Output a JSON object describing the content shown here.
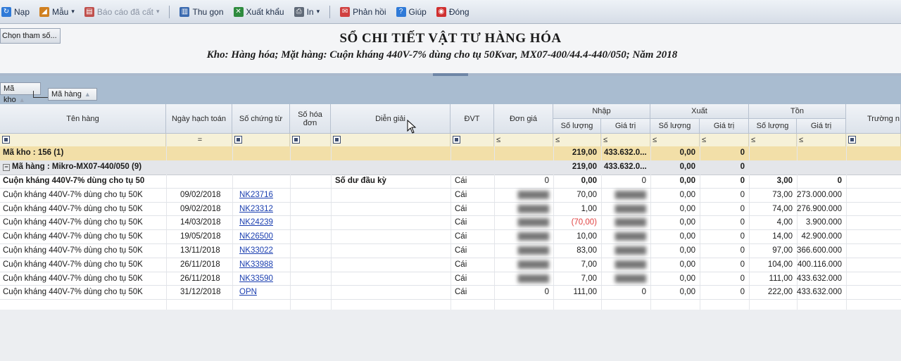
{
  "toolbar": {
    "items": [
      {
        "label": "Nạp",
        "icon": "refresh-icon",
        "color": "#2f7ad8"
      },
      {
        "label": "Mẫu",
        "icon": "template-icon",
        "color": "#d08020"
      },
      {
        "label": "Báo cáo đã cất",
        "icon": "save-report-icon",
        "color": "#c0504d"
      },
      {
        "label": "Thu gọn",
        "icon": "collapse-icon",
        "color": "#3a6ab0"
      },
      {
        "label": "Xuất khẩu",
        "icon": "excel-export-icon",
        "color": "#2e8b3e"
      },
      {
        "label": "In",
        "icon": "printer-icon",
        "color": "#606a78"
      },
      {
        "label": "Phản hồi",
        "icon": "feedback-icon",
        "color": "#d04040"
      },
      {
        "label": "Giúp",
        "icon": "help-icon",
        "color": "#2f7ad8"
      },
      {
        "label": "Đóng",
        "icon": "close-icon",
        "color": "#d03030"
      }
    ]
  },
  "report": {
    "chon_label": "Chọn tham số...",
    "title": "SỔ CHI TIẾT VẬT TƯ HÀNG HÓA",
    "subtitle": "Kho: Hàng hóa; Mặt hàng: Cuộn kháng 440V-7% dùng cho tụ 50Kvar, MX07-400/44.4-440/050; Năm 2018"
  },
  "grouping": {
    "level1": "Mã kho",
    "level2": "Mã hàng"
  },
  "columns": {
    "ten_hang": "Tên hàng",
    "ngay_hach_toan": "Ngày hạch toán",
    "so_chung_tu": "Số chứng từ",
    "so_hoa_don": "Số hóa đơn",
    "dien_giai": "Diễn giải",
    "dvt": "ĐVT",
    "don_gia": "Đơn giá",
    "nhap": "Nhập",
    "xuat": "Xuất",
    "ton": "Tồn",
    "so_luong": "Số lượng",
    "gia_tri": "Giá trị",
    "truong": "Trường n"
  },
  "filter": {
    "eq": "=",
    "le": "≤"
  },
  "group_rows": {
    "kho": {
      "label": "Mã kho : 156 (1)",
      "nhap_sl": "219,00",
      "nhap_gt": "433.632.0...",
      "xuat_sl": "0,00",
      "xuat_gt": "0"
    },
    "hang": {
      "label": "Mã hàng : Mikro-MX07-440/050 (9)",
      "nhap_sl": "219,00",
      "nhap_gt": "433.632.0...",
      "xuat_sl": "0,00",
      "xuat_gt": "0"
    }
  },
  "rows": [
    {
      "ten_hang": "Cuộn kháng 440V-7% dùng cho tụ 50",
      "ngay": "",
      "so_ct": "",
      "dien_giai": "Số dư đầu kỳ",
      "dvt": "Cái",
      "don_gia": "0",
      "nhap_sl": "0,00",
      "nhap_gt": "0",
      "xuat_sl": "0,00",
      "xuat_gt": "0",
      "ton_sl": "3,00",
      "ton_gt": "0",
      "bold": true
    },
    {
      "ten_hang": "Cuộn kháng 440V-7% dùng cho tụ 50K",
      "ngay": "09/02/2018",
      "so_ct": "NK23716",
      "dien_giai": "",
      "dvt": "Cái",
      "don_gia": "",
      "nhap_sl": "70,00",
      "nhap_gt": "",
      "xuat_sl": "0,00",
      "xuat_gt": "0",
      "ton_sl": "73,00",
      "ton_gt": "273.000.000"
    },
    {
      "ten_hang": "Cuộn kháng 440V-7% dùng cho tụ 50K",
      "ngay": "09/02/2018",
      "so_ct": "NK23312",
      "dien_giai": "",
      "dvt": "Cái",
      "don_gia": "",
      "nhap_sl": "1,00",
      "nhap_gt": "",
      "xuat_sl": "0,00",
      "xuat_gt": "0",
      "ton_sl": "74,00",
      "ton_gt": "276.900.000"
    },
    {
      "ten_hang": "Cuộn kháng 440V-7% dùng cho tụ 50K",
      "ngay": "14/03/2018",
      "so_ct": "NK24239",
      "dien_giai": "",
      "dvt": "Cái",
      "don_gia": "",
      "nhap_sl": "(70,00)",
      "nhap_gt": "",
      "xuat_sl": "0,00",
      "xuat_gt": "0",
      "ton_sl": "4,00",
      "ton_gt": "3.900.000",
      "neg": true
    },
    {
      "ten_hang": "Cuộn kháng 440V-7% dùng cho tụ 50K",
      "ngay": "19/05/2018",
      "so_ct": "NK26500",
      "dien_giai": "",
      "dvt": "Cái",
      "don_gia": "",
      "nhap_sl": "10,00",
      "nhap_gt": "",
      "xuat_sl": "0,00",
      "xuat_gt": "0",
      "ton_sl": "14,00",
      "ton_gt": "42.900.000"
    },
    {
      "ten_hang": "Cuộn kháng 440V-7% dùng cho tụ 50K",
      "ngay": "13/11/2018",
      "so_ct": "NK33022",
      "dien_giai": "",
      "dvt": "Cái",
      "don_gia": "",
      "nhap_sl": "83,00",
      "nhap_gt": "",
      "xuat_sl": "0,00",
      "xuat_gt": "0",
      "ton_sl": "97,00",
      "ton_gt": "366.600.000"
    },
    {
      "ten_hang": "Cuộn kháng 440V-7% dùng cho tụ 50K",
      "ngay": "26/11/2018",
      "so_ct": "NK33988",
      "dien_giai": "",
      "dvt": "Cái",
      "don_gia": "",
      "nhap_sl": "7,00",
      "nhap_gt": "",
      "xuat_sl": "0,00",
      "xuat_gt": "0",
      "ton_sl": "104,00",
      "ton_gt": "400.116.000"
    },
    {
      "ten_hang": "Cuộn kháng 440V-7% dùng cho tụ 50K",
      "ngay": "26/11/2018",
      "so_ct": "NK33590",
      "dien_giai": "",
      "dvt": "Cái",
      "don_gia": "",
      "nhap_sl": "7,00",
      "nhap_gt": "",
      "xuat_sl": "0,00",
      "xuat_gt": "0",
      "ton_sl": "111,00",
      "ton_gt": "433.632.000"
    },
    {
      "ten_hang": "Cuộn kháng 440V-7% dùng cho tụ 50K",
      "ngay": "31/12/2018",
      "so_ct": "OPN",
      "dien_giai": "",
      "dvt": "Cái",
      "don_gia": "0",
      "nhap_sl": "111,00",
      "nhap_gt": "0",
      "xuat_sl": "0,00",
      "xuat_gt": "0",
      "ton_sl": "222,00",
      "ton_gt": "433.632.000"
    }
  ]
}
